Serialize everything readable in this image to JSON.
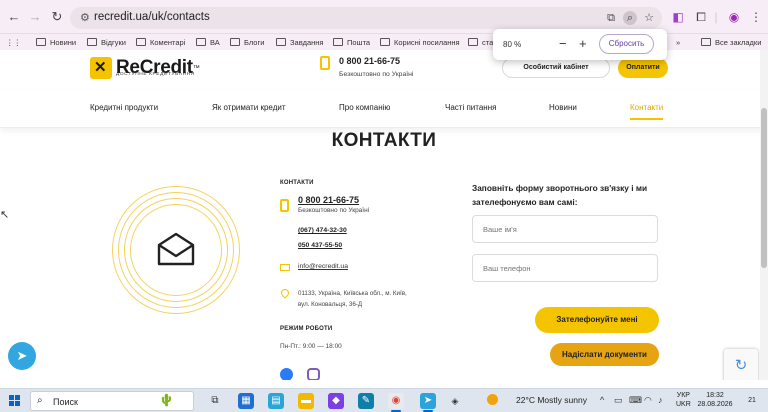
{
  "browser": {
    "url": "recredit.ua/uk/contacts",
    "bookmarks": [
      "Новини",
      "Відгуки",
      "Коментарі",
      "ВА",
      "Блоги",
      "Завдання",
      "Пошта",
      "Корисні посилання",
      "ста"
    ],
    "all_bookmarks_label": "Все закладки",
    "zoom_popup": {
      "value": "80 %",
      "minus": "−",
      "plus": "+",
      "reset_label": "Сбросить"
    }
  },
  "site": {
    "logo": {
      "name": "ReCredit",
      "tm": "™",
      "tagline": "ДОСТУПНЕ КРЕДИТУВАННЯ"
    },
    "header": {
      "phone": "0 800 21-66-75",
      "phone_note": "Безкоштовно по Україні",
      "cabinet_label": "Особистий кабінет",
      "pay_label": "Оплатити"
    },
    "menu": [
      "Кредитні продукти",
      "Як отримати кредит",
      "Про компанію",
      "Часті питання",
      "Новини",
      "Контакти"
    ],
    "page_title": "КОНТАКТИ",
    "contacts": {
      "label": "КОНТАКТИ",
      "main_phone": "0 800 21-66-75",
      "main_phone_note": "Безкоштовно по Україні",
      "phone2": "(067) 474-32-30",
      "phone3": "050 437-55-50",
      "email": "info@recredit.ua",
      "address_line1": "01133, Україна, Київська обл., м. Київ,",
      "address_line2": "вул. Коновальця, 36-Д",
      "work_label": "РЕЖИМ РОБОТИ",
      "work_hours": "Пн-Пт.: 9:00 — 18:00"
    },
    "form": {
      "title": "Заповніть форму зворотнього зв'язку і ми зателефонуємо вам самі:",
      "name_placeholder": "Ваше ім'я",
      "phone_placeholder": "Ваш телефон",
      "call_button": "Зателефонуйте мені",
      "docs_button": "Надіслати документи"
    }
  },
  "taskbar": {
    "search_label": "Поиск",
    "weather": "22°C  Mostly sunny",
    "lang_line1": "УКР",
    "lang_line2": "UKR",
    "time": "18:32",
    "date": "28.08.2026",
    "notification_count": "21"
  },
  "colors": {
    "accent": "#f5c400",
    "accent_dark": "#e6a412",
    "browser_bg": "#f7edf6"
  }
}
